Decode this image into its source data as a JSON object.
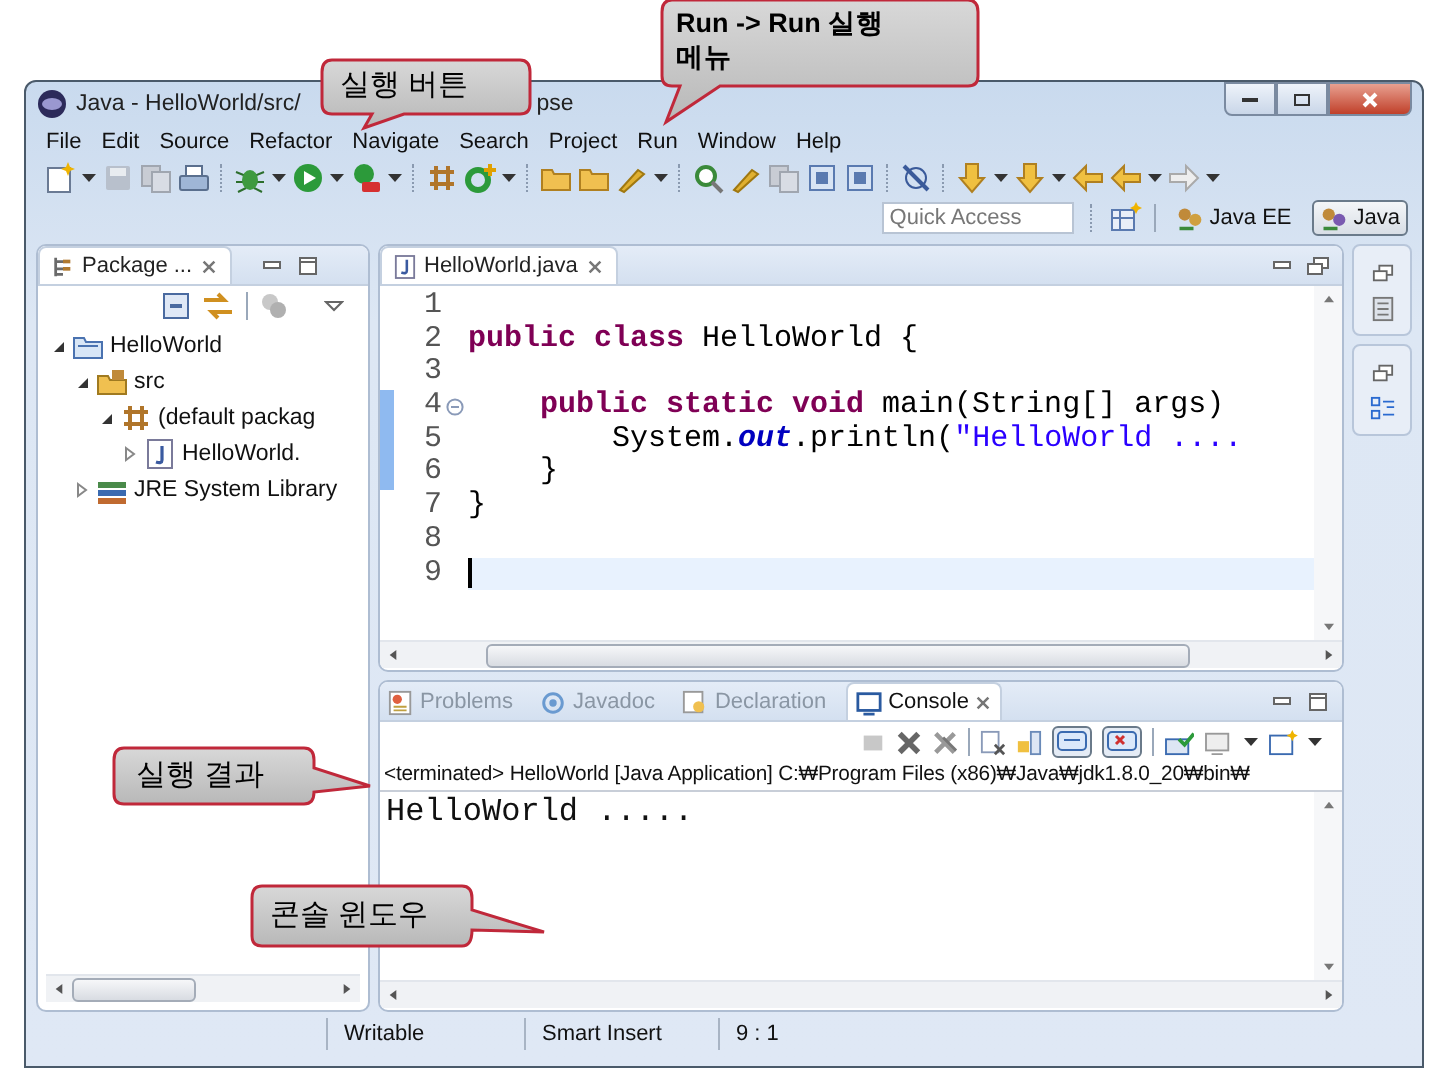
{
  "window": {
    "title": "Java - HelloWorld/src/",
    "title_tail": "pse"
  },
  "menu": [
    "File",
    "Edit",
    "Source",
    "Refactor",
    "Navigate",
    "Search",
    "Project",
    "Run",
    "Window",
    "Help"
  ],
  "quick_access": {
    "placeholder": "Quick Access"
  },
  "perspectives": [
    {
      "label": "Java EE",
      "selected": false
    },
    {
      "label": "Java",
      "selected": true
    }
  ],
  "package_explorer": {
    "title": "Package ...",
    "tree": [
      {
        "label": "HelloWorld",
        "kind": "project",
        "expanded": true,
        "children": [
          {
            "label": "src",
            "kind": "folder",
            "expanded": true,
            "children": [
              {
                "label": "(default packag",
                "kind": "package",
                "expanded": true,
                "children": [
                  {
                    "label": "HelloWorld.",
                    "kind": "file",
                    "expanded": false
                  }
                ]
              }
            ]
          },
          {
            "label": "JRE System Library",
            "kind": "library",
            "expanded": false
          }
        ]
      }
    ]
  },
  "editor": {
    "tab": "HelloWorld.java",
    "lines": [
      {
        "number": "1",
        "marked": false,
        "foldable": false,
        "current": false
      },
      {
        "number": "2",
        "marked": false,
        "foldable": false,
        "current": false,
        "tokens": [
          {
            "kind": "keyword",
            "text": "public class"
          },
          {
            "kind": "plain",
            "text": " HelloWorld {"
          }
        ]
      },
      {
        "number": "3",
        "marked": false,
        "foldable": false,
        "current": false
      },
      {
        "number": "4",
        "marked": true,
        "foldable": true,
        "current": false,
        "tokens": [
          {
            "kind": "keyword",
            "text": "    public static void"
          },
          {
            "kind": "plain",
            "text": " main(String[] args)"
          }
        ]
      },
      {
        "number": "5",
        "marked": true,
        "foldable": false,
        "current": false,
        "tokens": [
          {
            "kind": "plain",
            "text": "        System."
          },
          {
            "kind": "field",
            "text": "out"
          },
          {
            "kind": "plain",
            "text": ".println("
          },
          {
            "kind": "string",
            "text": "\"HelloWorld ...."
          }
        ]
      },
      {
        "number": "6",
        "marked": true,
        "foldable": false,
        "current": false,
        "tokens": [
          {
            "kind": "plain",
            "text": "    }"
          }
        ]
      },
      {
        "number": "7",
        "marked": false,
        "foldable": false,
        "current": false,
        "tokens": [
          {
            "kind": "plain",
            "text": "}"
          }
        ]
      },
      {
        "number": "8",
        "marked": false,
        "foldable": false,
        "current": false
      },
      {
        "number": "9",
        "marked": false,
        "foldable": false,
        "current": true
      }
    ]
  },
  "console": {
    "tabs": [
      {
        "label": "Problems",
        "selected": false
      },
      {
        "label": "Javadoc",
        "selected": false
      },
      {
        "label": "Declaration",
        "selected": false
      },
      {
        "label": "Console",
        "selected": true
      }
    ],
    "header": "<terminated> HelloWorld [Java Application] C:₩Program Files (x86)₩Java₩jdk1.8.0_20₩bin₩",
    "output": "HelloWorld ....."
  },
  "status_bar": [
    "Writable",
    "Smart Insert",
    "9 : 1"
  ],
  "callouts": [
    {
      "text": "실행 버튼"
    },
    {
      "text": "Run -> Run 실행\n메뉴"
    },
    {
      "text": "실행 결과"
    },
    {
      "text": "콘솔 윈도우"
    }
  ]
}
